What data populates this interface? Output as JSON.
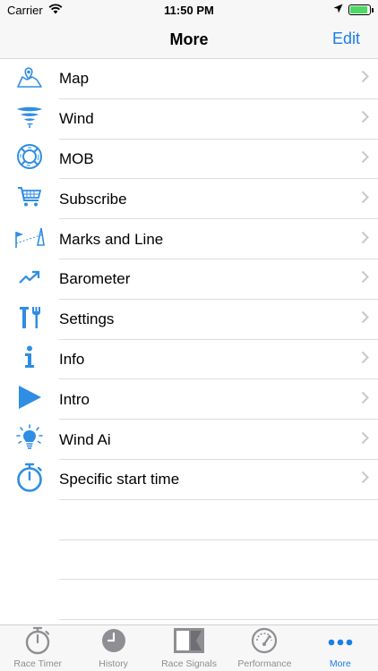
{
  "status_bar": {
    "carrier": "Carrier",
    "time": "11:50 PM"
  },
  "nav": {
    "title": "More",
    "edit_label": "Edit"
  },
  "menu": [
    {
      "label": "Map",
      "icon": "map-icon"
    },
    {
      "label": "Wind",
      "icon": "wind-icon"
    },
    {
      "label": "MOB",
      "icon": "lifebuoy-icon"
    },
    {
      "label": "Subscribe",
      "icon": "cart-icon"
    },
    {
      "label": "Marks and Line",
      "icon": "marks-line-icon"
    },
    {
      "label": "Barometer",
      "icon": "trend-up-icon"
    },
    {
      "label": "Settings",
      "icon": "tools-icon"
    },
    {
      "label": "Info",
      "icon": "info-icon"
    },
    {
      "label": "Intro",
      "icon": "play-icon"
    },
    {
      "label": "Wind Ai",
      "icon": "lightbulb-icon"
    },
    {
      "label": "Specific start time",
      "icon": "stopwatch-icon"
    }
  ],
  "tabs": [
    {
      "label": "Race Timer",
      "icon": "stopwatch-icon",
      "active": false
    },
    {
      "label": "History",
      "icon": "clock-icon",
      "active": false
    },
    {
      "label": "Race Signals",
      "icon": "flag-icon",
      "active": false
    },
    {
      "label": "Performance",
      "icon": "gauge-icon",
      "active": false
    },
    {
      "label": "More",
      "icon": "more-dots-icon",
      "active": true
    }
  ],
  "colors": {
    "accent": "#1a7ee6",
    "icon_blue": "#2f8de4",
    "inactive": "#8e8e93"
  }
}
